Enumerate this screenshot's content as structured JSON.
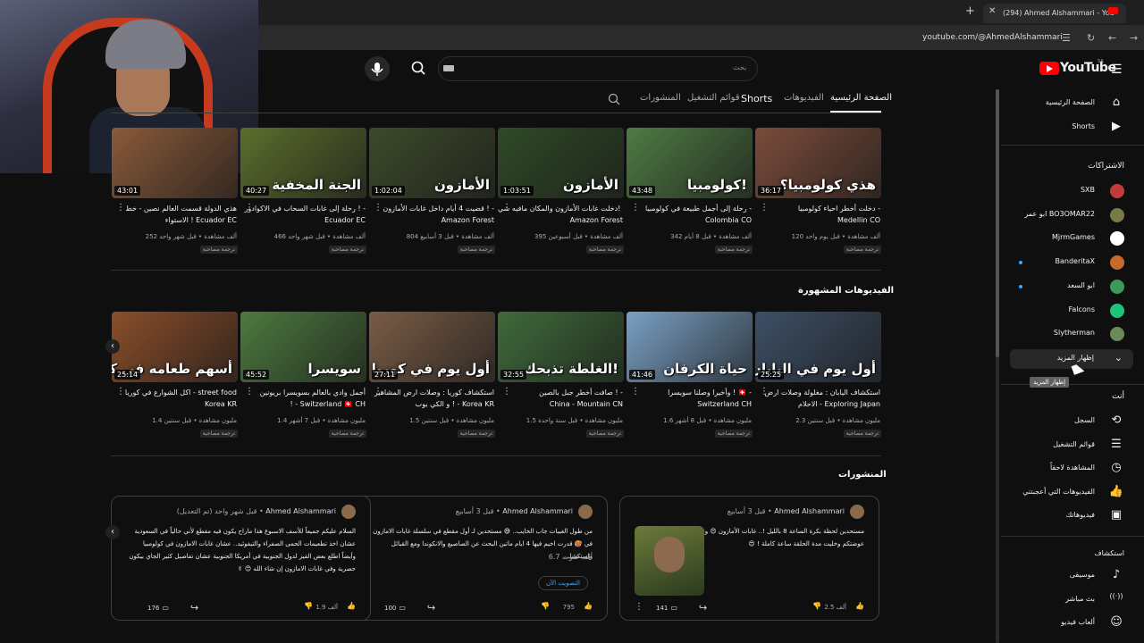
{
  "browser": {
    "tab_title": "(294) Ahmed Alshammari - You",
    "tab_close": "✕",
    "new_tab": "+",
    "url": "youtube.com/@AhmedAlshammari",
    "nav_icons": [
      "tune-icon",
      "reload-icon",
      "back-icon",
      "forward-icon"
    ]
  },
  "header": {
    "logo_text": "YouTube",
    "country": "SA",
    "search_placeholder": "بحث",
    "icons": {
      "search": "search-icon",
      "mic": "mic-icon",
      "menu": "hamburger-menu-icon"
    }
  },
  "channel_tabs": [
    {
      "label": "الصفحة الرئيسية",
      "active": true
    },
    {
      "label": "الفيديوهات",
      "active": false
    },
    {
      "label": "Shorts",
      "active": false
    },
    {
      "label": "قوائم التشغيل",
      "active": false
    },
    {
      "label": "المنشورات",
      "active": false
    }
  ],
  "row1": [
    {
      "duration": "36:17",
      "overlay": "هذي كولومبيا؟",
      "title1": "دخلت أخطر احياء كولومبيا -",
      "title2": "Medellin CO",
      "meta": "120 ألف مشاهدة • قبل يوم واحد",
      "badge": "ترجمة مصاحبة",
      "bg": "#7b4c3a"
    },
    {
      "duration": "43:48",
      "overlay": "كولومبيا!",
      "title1": "رحلة إلى أجمل طبيعة في كولومبيا -",
      "title2": "Colombia CO",
      "meta": "342 ألف مشاهدة • قبل 8 أيام",
      "badge": "ترجمة مصاحبة",
      "bg": "#4f7a44"
    },
    {
      "duration": "1:03:51",
      "overlay": "الأمازون",
      "title1": "دخلت غابات الأمازون والمكان مافيه شي! -",
      "title2": "Amazon Forest",
      "meta": "395 ألف مشاهدة • قبل أسبوعين",
      "badge": "ترجمة مصاحبة",
      "bg": "#2f4a26"
    },
    {
      "duration": "1:02:04",
      "overlay": "الأمازون",
      "title1": "قضيت 4 أيام داخل غابات الأمازون ! -",
      "title2": "Amazon Forest",
      "meta": "804 ألف مشاهدة • قبل 3 أسابيع",
      "badge": "ترجمة مصاحبة",
      "bg": "#3c4a2a"
    },
    {
      "duration": "40:27",
      "overlay": "الجنة المخفية",
      "title1": "رحلة إلى غابات السحاب في الاكوادور ! -",
      "title2": "Ecuador EC",
      "meta": "466 ألف مشاهدة • قبل شهر واحد",
      "badge": "ترجمة مصاحبة",
      "bg": "#5b6e2c"
    },
    {
      "duration": "43:01",
      "overlay": "",
      "title1": "هذي الدولة قسمت العالم نصين - خط",
      "title2": "الاستواء ! Ecuador EC",
      "meta": "252 ألف مشاهدة • قبل شهر واحد",
      "badge": "ترجمة مصاحبة",
      "bg": "#8a5a3a"
    }
  ],
  "featured_title": "الفيديوهات المشهورة",
  "row2": [
    {
      "duration": "25:25",
      "overlay": "أول يوم في اليابان",
      "title1": "استكشاف اليابان : مغلولة وصلات ارض",
      "title2": "الاحلام - Exploring Japan",
      "meta": "2.3 مليون مشاهدة • قبل سنتين",
      "badge": "ترجمة مصاحبة",
      "bg": "#3d4f66"
    },
    {
      "duration": "41:46",
      "overlay": "حياة الكرفان",
      "title1": "وأخيرا وصلنا سويسرا ! 🇨🇭 -",
      "title2": "Switzerland CH",
      "meta": "1.6 مليون مشاهدة • قبل 8 أشهر",
      "badge": "ترجمة مصاحبة",
      "bg": "#7aa0c4"
    },
    {
      "duration": "32:55",
      "overlay": "الغلطة تذبحك!",
      "title1": "صافت أخطر جبل بالصين ! -",
      "title2": "China - Mountain CN",
      "meta": "1.5 مليون مشاهدة • قبل سنة واحدة",
      "badge": "ترجمة مصاحبة",
      "bg": "#3f6b3a"
    },
    {
      "duration": "27:11",
      "overlay": "أول يوم في كوريا",
      "title1": "استكشاف كوريا : وصلات ارض المشاهير",
      "title2": "و الكي بوب ! - Korea KR",
      "meta": "1.5 مليون مشاهدة • قبل سنتين",
      "badge": "ترجمة مصاحبة",
      "bg": "#7a5c46"
    },
    {
      "duration": "45:52",
      "overlay": "سويسرا",
      "title1": "أجمل وادي بالعالم بسويسرا بريونين",
      "title2": "! - Switzerland 🇨🇭 CH",
      "meta": "1.4 مليون مشاهدة • قبل 7 أشهر",
      "badge": "ترجمة مصاحبة",
      "bg": "#4d7a3f"
    },
    {
      "duration": "25:14",
      "overlay": "أسهم طعامه في كوريا",
      "title1": "اكل الشوارع في كوريا - street food",
      "title2": "Korea KR",
      "meta": "1.4 مليون مشاهدة • قبل سنتين",
      "badge": "ترجمة مصاحبة",
      "bg": "#8a4e2a"
    }
  ],
  "posts_title": "المنشورات",
  "posts": [
    {
      "author": "Ahmed Alshammari",
      "time": "قبل 3 أسابيع",
      "text": "مستحدين لحظة بكرة الساعة 8 بالليل !.. غابات الأمازون 😍 وترالي عوضتكم وخليت مدة الحلقة ساعة كاملة ! 😍",
      "likes": "2.5 ألف",
      "comments": "141",
      "has_image": true
    },
    {
      "author": "Ahmed Alshammari",
      "time": "قبل 3 أسابيع",
      "text": "من طول الغيبات جاب الخايب.. 😅 مستحدين لـ أول مقطع في سلسلة غابات الامازون ! في 🥵 قدرت اخيم فيها 4 ايام ماتين البحث عن الصاصيع والانكوندا ومع القبائل واستكشا...",
      "votes": "6.7 ألف صوت",
      "vote_btn": "التصويت الآن",
      "likes": "795",
      "comments": "100",
      "has_image": false
    },
    {
      "author": "Ahmed Alshammari",
      "time": "قبل شهر واحد (تم التعديل)",
      "text": "السلام عليكم جميعاً للأسف الاسبوع هذا ماراح يكون فيه مقطع لأني حالياً في السعودية عشان اخذ تطعيمات الحمى الصفراء والتيفوئيد.. عشان غابات الامازون في كولومبيا وأيضاً اطلع بعض الفيز لدول الجنوبية في أمريكا الجنوبية عشان تفاصيل كثير الجاي بيكون حصرية وفي غابات الامازون إن شاء الله 😊 ✌",
      "likes": "1.9 ألف",
      "comments": "176",
      "has_image": false
    }
  ],
  "sidebar": {
    "top": [
      {
        "label": "الصفحة الرئيسية",
        "icon": "home-icon"
      },
      {
        "label": "Shorts",
        "icon": "shorts-icon"
      }
    ],
    "subs_header": "الاشتراكات",
    "subs": [
      {
        "label": "SXB",
        "color": "#c43a3a",
        "dot": false
      },
      {
        "label": "ابو عمر BO3OMAR22",
        "color": "#7a7a46",
        "dot": false
      },
      {
        "label": "MjrmGames",
        "color": "#ffffff",
        "dot": false
      },
      {
        "label": "BanderitaX",
        "color": "#c46a2a",
        "dot": true
      },
      {
        "label": "ابو السعد",
        "color": "#3a9a5a",
        "dot": true
      },
      {
        "label": "Falcons",
        "color": "#1ec47a",
        "dot": false
      },
      {
        "label": "Slytherman",
        "color": "#6a8a5a",
        "dot": false
      }
    ],
    "show_more": "إظهار المزيد",
    "tooltip": "إظهار المزيد",
    "you_header": "أنت",
    "you": [
      {
        "label": "السجل",
        "icon": "history-icon"
      },
      {
        "label": "قوائم التشغيل",
        "icon": "playlist-icon"
      },
      {
        "label": "المشاهدة لاحقاً",
        "icon": "watch-later-icon"
      },
      {
        "label": "الفيديوهات التي أعجبتني",
        "icon": "like-icon"
      },
      {
        "label": "فيديوهاتك",
        "icon": "your-videos-icon"
      }
    ],
    "explore_header": "استكشاف",
    "explore": [
      {
        "label": "موسيقى",
        "icon": "music-icon"
      },
      {
        "label": "بث مباشر",
        "icon": "live-icon"
      },
      {
        "label": "ألعاب فيديو",
        "icon": "gaming-icon"
      }
    ]
  },
  "colors": {
    "bg": "#0f0f0f",
    "accent": "#ff0000",
    "text": "#f1f1f1",
    "muted": "#aaaaaa",
    "link": "#3ea6ff"
  }
}
